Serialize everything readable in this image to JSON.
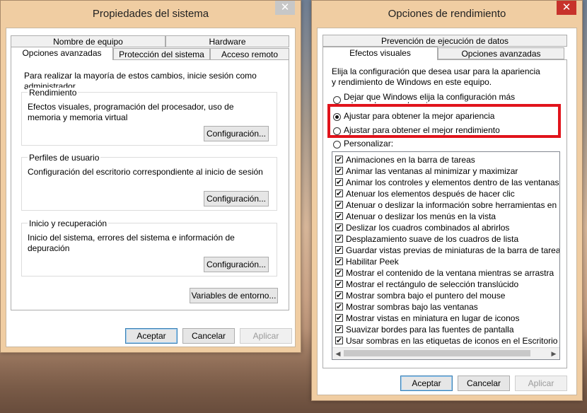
{
  "left_window": {
    "title": "Propiedades del sistema",
    "close": "✕",
    "tabs_row1": [
      "Nombre de equipo",
      "Hardware"
    ],
    "tabs_row2": [
      "Opciones avanzadas",
      "Protección del sistema",
      "Acceso remoto"
    ],
    "admin_note": "Para realizar la mayoría de estos cambios, inicie sesión como administrador.",
    "groups": [
      {
        "title": "Rendimiento",
        "desc": "Efectos visuales, programación del procesador, uso de memoria y memoria virtual",
        "button": "Configuración..."
      },
      {
        "title": "Perfiles de usuario",
        "desc": "Configuración del escritorio correspondiente al inicio de sesión",
        "button": "Configuración..."
      },
      {
        "title": "Inicio y recuperación",
        "desc": "Inicio del sistema, errores del sistema e información de depuración",
        "button": "Configuración..."
      }
    ],
    "env_button": "Variables de entorno...",
    "buttons": {
      "ok": "Aceptar",
      "cancel": "Cancelar",
      "apply": "Aplicar"
    }
  },
  "right_window": {
    "title": "Opciones de rendimiento",
    "close": "✕",
    "tab_top": "Prevención de ejecución de datos",
    "tabs": [
      "Efectos visuales",
      "Opciones avanzadas"
    ],
    "intro": "Elija la configuración que desea usar para la apariencia y rendimiento de Windows en este equipo.",
    "radios": [
      {
        "label": "Dejar que Windows elija la configuración más adecuada para el equipo",
        "selected": false
      },
      {
        "label": "Ajustar para obtener la mejor apariencia",
        "selected": true
      },
      {
        "label": "Ajustar para obtener el mejor rendimiento",
        "selected": false
      },
      {
        "label": "Personalizar:",
        "selected": false
      }
    ],
    "effects": [
      "Animaciones en la barra de tareas",
      "Animar las ventanas al minimizar y maximizar",
      "Animar los controles y elementos dentro de las ventanas",
      "Atenuar los elementos después de hacer clic",
      "Atenuar o deslizar la información sobre herramientas en la vista",
      "Atenuar o deslizar los menús en la vista",
      "Deslizar los cuadros combinados al abrirlos",
      "Desplazamiento suave de los cuadros de lista",
      "Guardar vistas previas de miniaturas de la barra de tareas",
      "Habilitar Peek",
      "Mostrar el contenido de la ventana mientras se arrastra",
      "Mostrar el rectángulo de selección translúcido",
      "Mostrar sombra bajo el puntero del mouse",
      "Mostrar sombras bajo las ventanas",
      "Mostrar vistas en miniatura en lugar de iconos",
      "Suavizar bordes para las fuentes de pantalla",
      "Usar sombras en las etiquetas de iconos en el Escritorio"
    ],
    "buttons": {
      "ok": "Aceptar",
      "cancel": "Cancelar",
      "apply": "Aplicar"
    }
  },
  "colors": {
    "highlight": "#e1141c",
    "close_red": "#c7322b",
    "frame": "#f0cda2"
  }
}
